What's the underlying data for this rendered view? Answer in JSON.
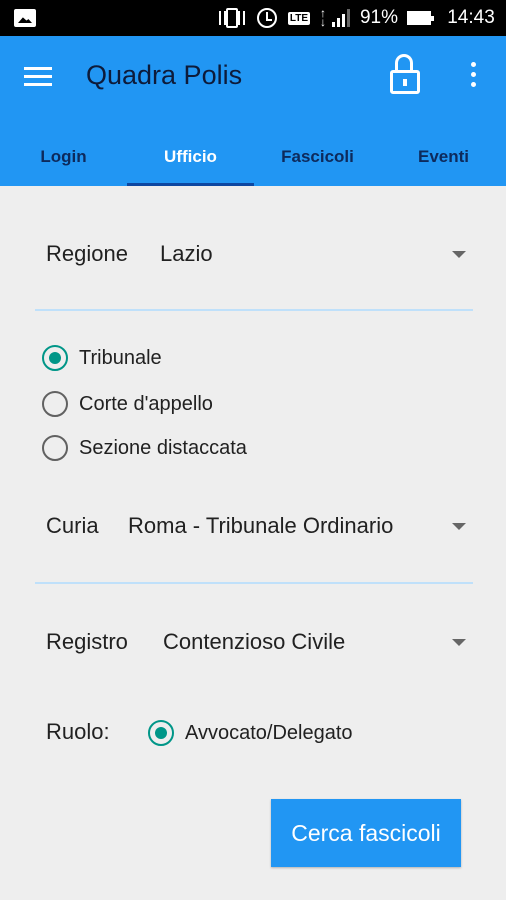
{
  "status_bar": {
    "icons": [
      "gallery-icon",
      "vibrate-icon",
      "alarm-icon",
      "lte-icon",
      "data-arrows-icon",
      "signal-icon",
      "battery-icon"
    ],
    "lte_label": "LTE",
    "battery_percent": "91%",
    "time": "14:43"
  },
  "app_bar": {
    "title": "Quadra Polis",
    "icons": [
      "menu-icon",
      "unlock-icon",
      "more-vert-icon"
    ],
    "color": "#2196f3"
  },
  "tabs": [
    {
      "label": "Login",
      "active": false
    },
    {
      "label": "Ufficio",
      "active": true
    },
    {
      "label": "Fascicoli",
      "active": false
    },
    {
      "label": "Eventi",
      "active": false
    }
  ],
  "form": {
    "regione": {
      "label": "Regione",
      "value": "Lazio"
    },
    "court_types": [
      {
        "label": "Tribunale",
        "checked": true
      },
      {
        "label": "Corte d'appello",
        "checked": false
      },
      {
        "label": "Sezione distaccata",
        "checked": false
      }
    ],
    "curia": {
      "label": "Curia",
      "value": "Roma - Tribunale Ordinario"
    },
    "registro": {
      "label": "Registro",
      "value": "Contenzioso Civile"
    },
    "ruolo": {
      "label": "Ruolo:",
      "option": "Avvocato/Delegato",
      "checked": true
    }
  },
  "search_button": {
    "label": "Cerca fascicoli"
  },
  "colors": {
    "accent": "#2196f3",
    "radio": "#009688",
    "divider": "#bfe0fa",
    "background": "#eeeeee"
  }
}
